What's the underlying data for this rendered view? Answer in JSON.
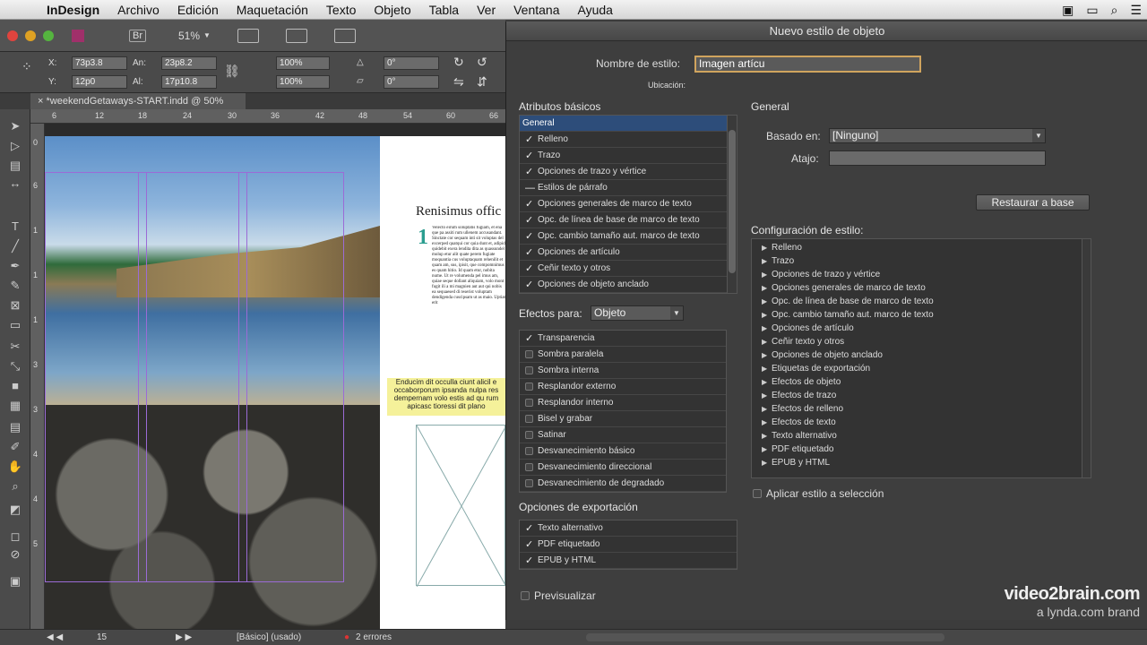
{
  "menubar": {
    "app": "InDesign",
    "items": [
      "Archivo",
      "Edición",
      "Maquetación",
      "Texto",
      "Objeto",
      "Tabla",
      "Ver",
      "Ventana",
      "Ayuda"
    ]
  },
  "appbar": {
    "bridge": "Br",
    "zoom": "51%"
  },
  "control": {
    "x_label": "X:",
    "x_value": "73p3.8",
    "y_label": "Y:",
    "y_value": "12p0",
    "w_label": "An:",
    "w_value": "23p8.2",
    "h_label": "Al:",
    "h_value": "17p10.8",
    "scale_x": "100%",
    "scale_y": "100%",
    "rot": "0°",
    "shear": "0°"
  },
  "document": {
    "tab_title": "*weekendGetaways-START.indd @ 50%",
    "ruler_h": [
      "6",
      "12",
      "18",
      "24",
      "30",
      "36",
      "42",
      "48",
      "54",
      "60",
      "66"
    ],
    "ruler_v": [
      "0",
      "6",
      "1",
      "1",
      "1",
      "3",
      "3",
      "4",
      "4",
      "5"
    ],
    "headline": "Renisimus offic",
    "drop_cap": "1",
    "body_text": "Velecto eirum soluptatis fugiam, et ena que pa assiti rum ullenem accusandant. Sinctate cor sequam inti sit voluptas del excerped quatqui cor quia dunt et, adipid quidebit exera lendita dita as quassundel molup etur alit quate perem fugiate moquantia cus voluptaquam rehenilit et quam am, sus, ipisit, que compomnimus es quam hitio. Id quam etur, nobita nume. Ut re volumenda pel imus am, quiae seque dollant aliquiam, volo mont fugit ili a mi magnien aut aut qui nobis ea sequaesed di reserist voluptam dendigenda cuscipsam ut as maio. Uptiat erit",
    "pull_quote": "Enducim dit occulla ciunt alicil e occaborporum ipsanda nulpa res dempernam volo estis ad qu rum apicasc tioressi dit plano"
  },
  "status": {
    "page": "15",
    "style": "[Básico] (usado)",
    "errors": "2 errores"
  },
  "dialog": {
    "title": "Nuevo estilo de objeto",
    "style_name_label": "Nombre de estilo:",
    "style_name_value": "Imagen artícu",
    "location_label": "Ubicación:",
    "basic_attrs_heading": "Atributos básicos",
    "basic_attrs": [
      {
        "label": "General",
        "state": "selected"
      },
      {
        "label": "Relleno",
        "state": "checked"
      },
      {
        "label": "Trazo",
        "state": "checked"
      },
      {
        "label": "Opciones de trazo y vértice",
        "state": "checked"
      },
      {
        "label": "Estilos de párrafo",
        "state": "mixed"
      },
      {
        "label": "Opciones generales de marco de texto",
        "state": "checked"
      },
      {
        "label": "Opc. de línea de base de marco de texto",
        "state": "checked"
      },
      {
        "label": "Opc. cambio tamaño aut. marco de texto",
        "state": "checked"
      },
      {
        "label": "Opciones de artículo",
        "state": "checked"
      },
      {
        "label": "Ceñir texto y otros",
        "state": "checked"
      },
      {
        "label": "Opciones de objeto anclado",
        "state": "checked"
      }
    ],
    "effects_for_label": "Efectos para:",
    "effects_for_value": "Objeto",
    "effects": [
      {
        "label": "Transparencia",
        "checked": true
      },
      {
        "label": "Sombra paralela",
        "checked": false
      },
      {
        "label": "Sombra interna",
        "checked": false
      },
      {
        "label": "Resplandor externo",
        "checked": false
      },
      {
        "label": "Resplandor interno",
        "checked": false
      },
      {
        "label": "Bisel y grabar",
        "checked": false
      },
      {
        "label": "Satinar",
        "checked": false
      },
      {
        "label": "Desvanecimiento básico",
        "checked": false
      },
      {
        "label": "Desvanecimiento direccional",
        "checked": false
      },
      {
        "label": "Desvanecimiento de degradado",
        "checked": false
      }
    ],
    "export_heading": "Opciones de exportación",
    "export_opts": [
      {
        "label": "Texto alternativo",
        "checked": true
      },
      {
        "label": "PDF etiquetado",
        "checked": true
      },
      {
        "label": "EPUB y HTML",
        "checked": true
      }
    ],
    "preview_label": "Previsualizar",
    "general_heading": "General",
    "based_on_label": "Basado en:",
    "based_on_value": "[Ninguno]",
    "shortcut_label": "Atajo:",
    "reset_button": "Restaurar a base",
    "config_heading": "Configuración de estilo:",
    "config_items": [
      "Relleno",
      "Trazo",
      "Opciones de trazo y vértice",
      "Opciones generales de marco de texto",
      "Opc. de línea de base de marco de texto",
      "Opc. cambio tamaño aut. marco de texto",
      "Opciones de artículo",
      "Ceñir texto y otros",
      "Opciones de objeto anclado",
      "Etiquetas de exportación",
      "Efectos de objeto",
      "Efectos de trazo",
      "Efectos de relleno",
      "Efectos de texto",
      "Texto alternativo",
      "PDF etiquetado",
      "EPUB y HTML"
    ],
    "apply_label": "Aplicar estilo a selección"
  },
  "watermark": {
    "line1": "video2brain.com",
    "line2": "a lynda.com brand"
  }
}
